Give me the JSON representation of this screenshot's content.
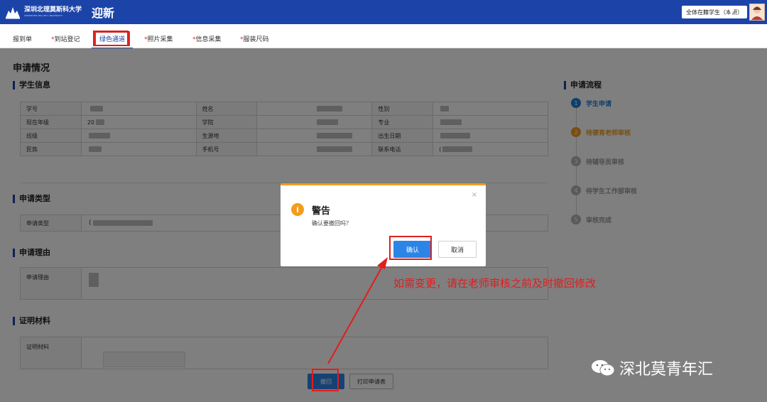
{
  "header": {
    "logo_cn": "深圳北理莫斯科大学",
    "logo_en": "SHENZHEN MSU-BIT UNIVERSITY",
    "app_title": "迎新",
    "user_role": "全体在籍学生（本研）"
  },
  "tabs": [
    {
      "label": "报到单",
      "required": ""
    },
    {
      "label": "到站登记",
      "required": "*"
    },
    {
      "label": "绿色通道",
      "required": ""
    },
    {
      "label": "照片采集",
      "required": "*"
    },
    {
      "label": "信息采集",
      "required": "*"
    },
    {
      "label": "服装尺码",
      "required": "*"
    }
  ],
  "page_title": "申请情况",
  "student_info": {
    "title": "学生信息",
    "rows": [
      [
        "学号",
        "",
        "姓名",
        "",
        "性别",
        ""
      ],
      [
        "现在年级",
        "20",
        "学院",
        "",
        "专业",
        ""
      ],
      [
        "班级",
        "",
        "生源地",
        "",
        "出生日期",
        ""
      ],
      [
        "民族",
        "",
        "手机号",
        "",
        "联系电话",
        "("
      ]
    ]
  },
  "application_type": {
    "title": "申请类型",
    "label": "申请类型",
    "value_prefix": "("
  },
  "application_reason": {
    "title": "申请理由",
    "label": "申请理由"
  },
  "proof": {
    "title": "证明材料",
    "label": "证明材料"
  },
  "flow": {
    "title": "申请流程",
    "steps": [
      {
        "num": "1",
        "label": "学生申请",
        "color": "#1c7ed6"
      },
      {
        "num": "2",
        "label": "待德育老师审核",
        "color": "#f29d1d"
      },
      {
        "num": "3",
        "label": "待辅导员审核",
        "color": "#b5b5b5"
      },
      {
        "num": "4",
        "label": "待学生工作部审核",
        "color": "#b5b5b5"
      },
      {
        "num": "5",
        "label": "审核完成",
        "color": "#b5b5b5"
      }
    ]
  },
  "actions": {
    "withdraw": "撤回",
    "print": "打印申请表"
  },
  "dialog": {
    "icon": "i",
    "close": "×",
    "title": "警告",
    "message": "确认要撤回吗？",
    "ok": "确认",
    "cancel": "取消"
  },
  "annotation": "如需变更，请在老师审核之前及时撤回修改",
  "watermark": "深北莫青年汇",
  "colors": {
    "brand": "#1c44a8",
    "warning": "#f29d1d",
    "primary": "#2c85e6",
    "highlight": "#e11d1d"
  }
}
